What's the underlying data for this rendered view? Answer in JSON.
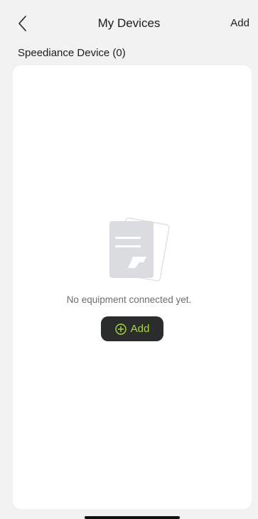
{
  "header": {
    "title": "My Devices",
    "add_label": "Add",
    "back_icon": "chevron-left-icon"
  },
  "section": {
    "title": "Speediance Device (0)"
  },
  "empty_state": {
    "illustration_icon": "empty-documents-icon",
    "message": "No equipment connected yet.",
    "add_button_label": "Add",
    "add_button_icon": "plus-circle-icon"
  },
  "colors": {
    "background": "#f2f2f2",
    "card": "#ffffff",
    "button_bg": "#2a2d2b",
    "accent": "#a8d63f",
    "muted_text": "#6e6e6e"
  }
}
